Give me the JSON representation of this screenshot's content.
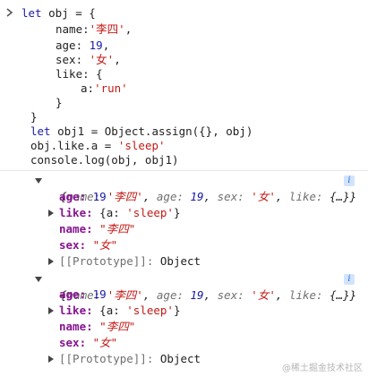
{
  "code": {
    "l1_let": "let",
    "l1_rest": " obj = {",
    "l2_key": "name:",
    "l2_val": "'李四'",
    "l2_comma": ",",
    "l3_key": "age:",
    "l3_val": "19",
    "l3_comma": ",",
    "l4_key": "sex:",
    "l4_val": "'女'",
    "l4_comma": ",",
    "l5": "like: {",
    "l6_key": "a:",
    "l6_val": "'run'",
    "l7": "}",
    "l8": "}",
    "l9_let": "let",
    "l9_rest": " obj1 = Object.assign({}, obj)",
    "l10_pre": "obj.like.a = ",
    "l10_val": "'sleep'",
    "l11": "console.log(obj, obj1)"
  },
  "log1": {
    "summary": {
      "open": "{",
      "k1": "name:",
      "v1": "'李四'",
      "c1": ",",
      "k2": "age:",
      "v2": "19",
      "c2": ",",
      "k3": "sex:",
      "v3": "'女'",
      "c3": ",",
      "k4": "like:",
      "v4": "{…}",
      "close": "}"
    },
    "age_key": "age:",
    "age_val": "19",
    "like_key": "like:",
    "like_pre": "{a: ",
    "like_val": "'sleep'",
    "like_post": "}",
    "name_key": "name:",
    "name_val": "\"李四\"",
    "sex_key": "sex:",
    "sex_val": "\"女\"",
    "proto_key": "[[Prototype]]:",
    "proto_val": "Object"
  },
  "log2": {
    "summary": {
      "open": "{",
      "k1": "name:",
      "v1": "'李四'",
      "c1": ",",
      "k2": "age:",
      "v2": "19",
      "c2": ",",
      "k3": "sex:",
      "v3": "'女'",
      "c3": ",",
      "k4": "like:",
      "v4": "{…}",
      "close": "}"
    },
    "age_key": "age:",
    "age_val": "19",
    "like_key": "like:",
    "like_pre": "{a: ",
    "like_val": "'sleep'",
    "like_post": "}",
    "name_key": "name:",
    "name_val": "\"李四\"",
    "sex_key": "sex:",
    "sex_val": "\"女\"",
    "proto_key": "[[Prototype]]:",
    "proto_val": "Object"
  },
  "badge": "i",
  "watermark": "@稀土掘金技术社区",
  "icons": {
    "prompt": "chevron-right-icon",
    "expand": "triangle-down-icon",
    "collapse": "triangle-right-icon",
    "info": "info-icon"
  }
}
